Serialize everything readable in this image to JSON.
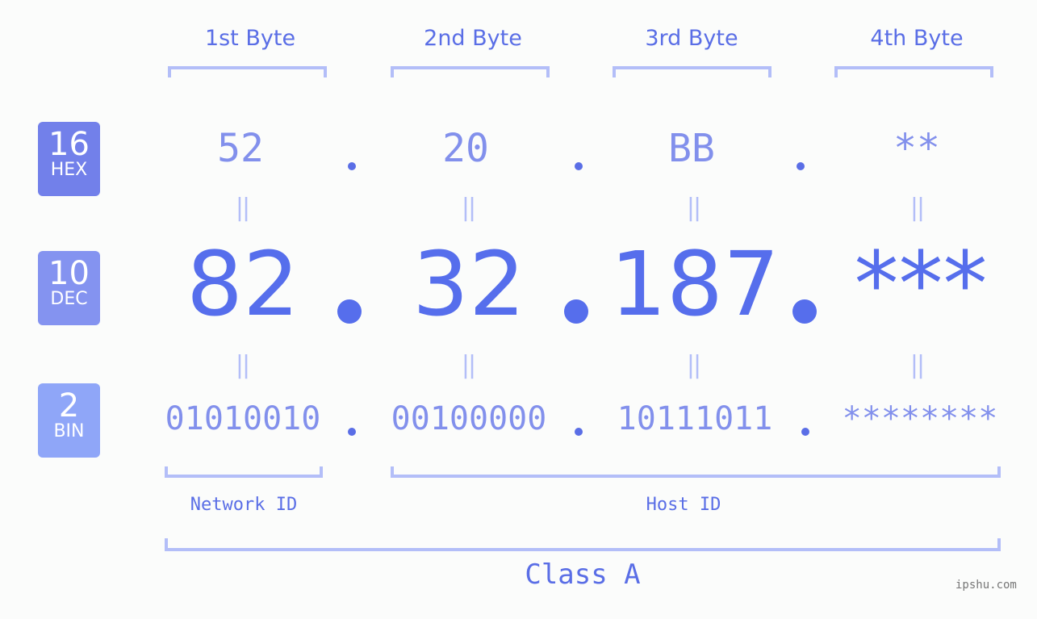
{
  "byte_headers": [
    "1st Byte",
    "2nd Byte",
    "3rd Byte",
    "4th Byte"
  ],
  "badges": {
    "hex": {
      "num": "16",
      "label": "HEX",
      "color": "#7280ea"
    },
    "dec": {
      "num": "10",
      "label": "DEC",
      "color": "#8493f0"
    },
    "bin": {
      "num": "2",
      "label": "BIN",
      "color": "#8fa6f8"
    }
  },
  "hex": [
    "52",
    "20",
    "BB",
    "**"
  ],
  "dec": [
    "82",
    "32",
    "187",
    "***"
  ],
  "bin": [
    "01010010",
    "00100000",
    "10111011",
    "********"
  ],
  "equals_symbol": "||",
  "labels": {
    "network_id": "Network ID",
    "host_id": "Host ID",
    "class": "Class A"
  },
  "brand": "ipshu.com",
  "colors": {
    "accent": "#566eec",
    "light_value": "#8290ec",
    "bracket": "#b3bef8",
    "background": "#fbfcfb"
  }
}
